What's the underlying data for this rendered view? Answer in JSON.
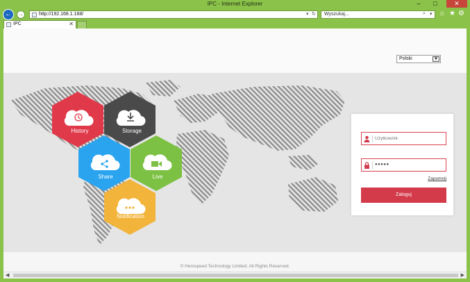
{
  "window": {
    "title": "IPC - Internet Explorer"
  },
  "controls": {
    "minimize": "–",
    "maximize": "□",
    "close": "✕"
  },
  "nav": {
    "back": "←",
    "forward": "→",
    "url": "http://192.168.1.168/",
    "dropdown": "▾",
    "refresh": "↻",
    "search_placeholder": "Wyszukaj...",
    "search_glyph": "⌕",
    "home": "⌂",
    "star": "★",
    "gear": "⚙"
  },
  "tab": {
    "label": "IPC",
    "close": "✕"
  },
  "page": {
    "language": "Polski",
    "language_arrow": "▼",
    "features": [
      "History",
      "Storage",
      "Share",
      "Live",
      "Notification"
    ],
    "login": {
      "username_placeholder": "Użytkownik",
      "password_value": "●●●●●",
      "forgot": "Zapomnij",
      "submit": "Zaloguj"
    },
    "footer": "© Herospeed Technology Limited. All Rights Reserved."
  },
  "scroll": {
    "left": "◀",
    "right": "▶"
  },
  "colors": {
    "history": "#e03a4a",
    "storage": "#4a4a4a",
    "share": "#2aa4ee",
    "live": "#7cc143",
    "notification": "#f2b43a",
    "accent": "#d33a4a"
  }
}
